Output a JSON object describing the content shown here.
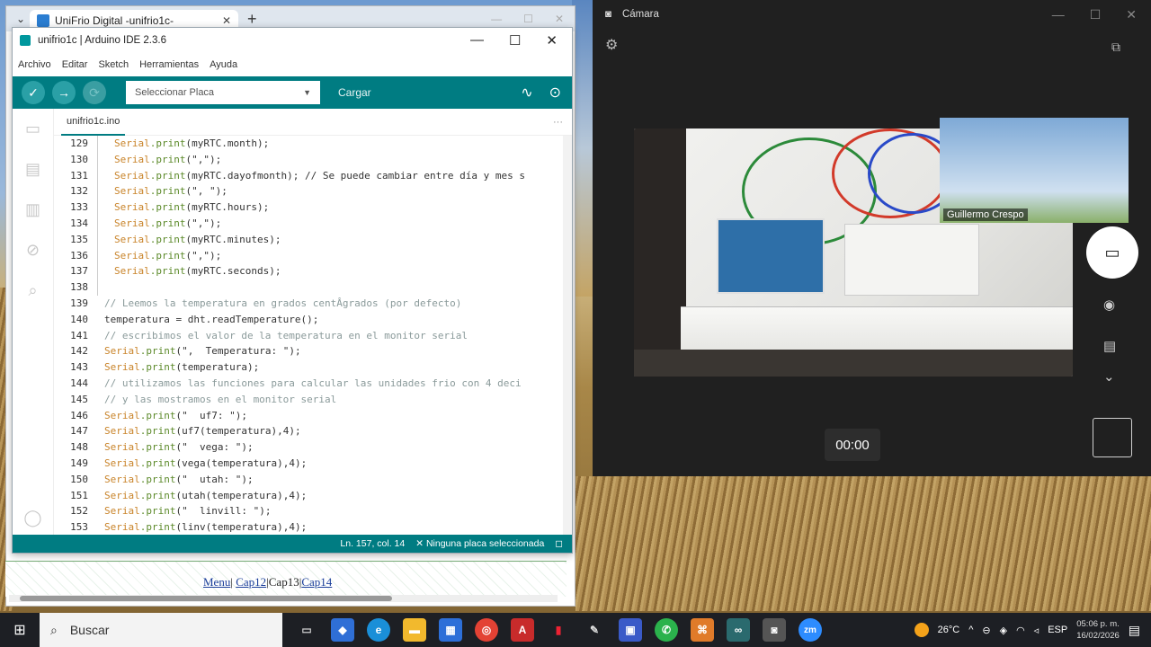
{
  "browser": {
    "tab_title": "UniFrio Digital -unifrio1c-",
    "nav": {
      "menu": "Menu",
      "sep1": "|",
      "cap12": "Cap12",
      "sep2": "|",
      "cap13": "Cap13",
      "sep3": "|",
      "cap14": "Cap14"
    }
  },
  "ide": {
    "title": "unifrio1c | Arduino IDE 2.3.6",
    "menu": [
      "Archivo",
      "Editar",
      "Sketch",
      "Herramientas",
      "Ayuda"
    ],
    "board_placeholder": "Seleccionar Placa",
    "upload_label": "Cargar",
    "file_tab": "unifrio1c.ino",
    "status_pos": "Ln. 157, col. 14",
    "status_board": "Ninguna placa seleccionada",
    "lines": [
      {
        "n": "129",
        "t": "Serial.print(myRTC.month);",
        "k": "in"
      },
      {
        "n": "130",
        "t": "Serial.print(\",\");",
        "k": "in"
      },
      {
        "n": "131",
        "t": "Serial.print(myRTC.dayofmonth); // Se puede cambiar entre día y mes s",
        "k": "in"
      },
      {
        "n": "132",
        "t": "Serial.print(\", \");",
        "k": "in"
      },
      {
        "n": "133",
        "t": "Serial.print(myRTC.hours);",
        "k": "in"
      },
      {
        "n": "134",
        "t": "Serial.print(\",\");",
        "k": "in"
      },
      {
        "n": "135",
        "t": "Serial.print(myRTC.minutes);",
        "k": "in"
      },
      {
        "n": "136",
        "t": "Serial.print(\",\");",
        "k": "in"
      },
      {
        "n": "137",
        "t": "Serial.print(myRTC.seconds);",
        "k": "in"
      },
      {
        "n": "138",
        "t": "",
        "k": "in"
      },
      {
        "n": "139",
        "t": "// Leemos la temperatura en grados centÂ­grados (por defecto)",
        "k": "cm"
      },
      {
        "n": "140",
        "t": "temperatura = dht.readTemperature();",
        "k": "code"
      },
      {
        "n": "141",
        "t": "// escribimos el valor de la temperatura en el monitor serial",
        "k": "cm"
      },
      {
        "n": "142",
        "t": "Serial.print(\",  Temperatura: \");",
        "k": "code"
      },
      {
        "n": "143",
        "t": "Serial.print(temperatura);",
        "k": "code"
      },
      {
        "n": "144",
        "t": "// utilizamos las funciones para calcular las unidades frio con 4 deci",
        "k": "cm"
      },
      {
        "n": "145",
        "t": "// y las mostramos en el monitor serial",
        "k": "cm"
      },
      {
        "n": "146",
        "t": "Serial.print(\"  uf7: \");",
        "k": "code"
      },
      {
        "n": "147",
        "t": "Serial.print(uf7(temperatura),4);",
        "k": "code"
      },
      {
        "n": "148",
        "t": "Serial.print(\"  vega: \");",
        "k": "code"
      },
      {
        "n": "149",
        "t": "Serial.print(vega(temperatura),4);",
        "k": "code"
      },
      {
        "n": "150",
        "t": "Serial.print(\"  utah: \");",
        "k": "code"
      },
      {
        "n": "151",
        "t": "Serial.print(utah(temperatura),4);",
        "k": "code"
      },
      {
        "n": "152",
        "t": "Serial.print(\"  linvill: \");",
        "k": "code"
      },
      {
        "n": "153",
        "t": "Serial.print(linv(temperatura),4);",
        "k": "code"
      }
    ]
  },
  "camera": {
    "title": "Cámara",
    "pip_name": "Guillermo Crespo",
    "timer": "00:00"
  },
  "taskbar": {
    "search_placeholder": "Buscar",
    "weather": "26°C",
    "lang": "ESP",
    "time": "05:06 p. m.",
    "date": "16/02/2026"
  },
  "colors": {
    "arduino_teal": "#007c82",
    "camera_bg": "#202020",
    "taskbar_bg": "#1d1f24"
  }
}
